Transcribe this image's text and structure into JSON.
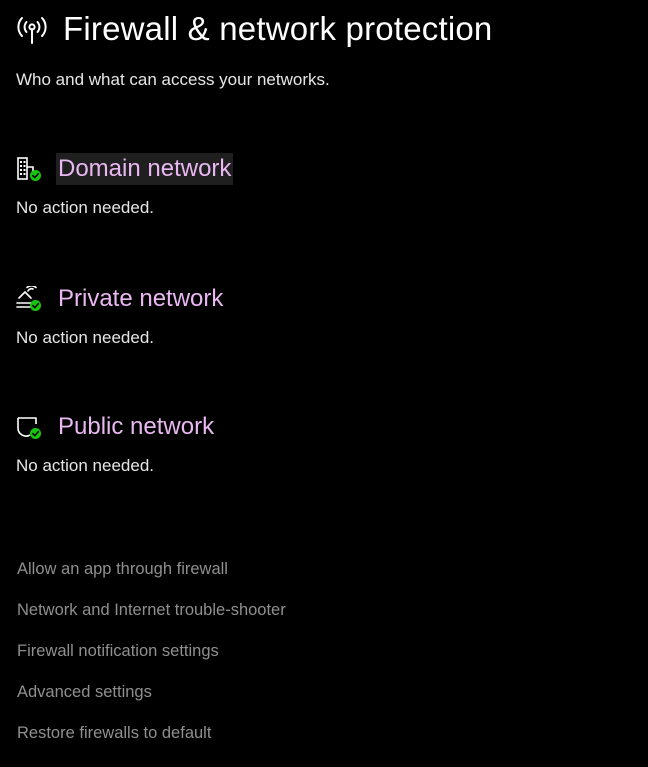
{
  "header": {
    "icon": "antenna-icon",
    "title": "Firewall & network protection",
    "subtitle": "Who and what can access your networks."
  },
  "networks": [
    {
      "icon": "domain-network-icon",
      "label": "Domain network",
      "status": "No action needed."
    },
    {
      "icon": "private-network-icon",
      "label": "Private network",
      "status": "No action needed."
    },
    {
      "icon": "public-network-icon",
      "label": "Public network",
      "status": "No action needed."
    }
  ],
  "links": [
    "Allow an app through firewall",
    "Network and Internet trouble-shooter",
    "Firewall notification settings",
    "Advanced settings",
    "Restore firewalls to default"
  ],
  "colors": {
    "background": "#000000",
    "title": "#ffffff",
    "network_link": "#e9b7f1",
    "status_check": "#16c60c",
    "secondary_link": "#8f8f8f"
  }
}
